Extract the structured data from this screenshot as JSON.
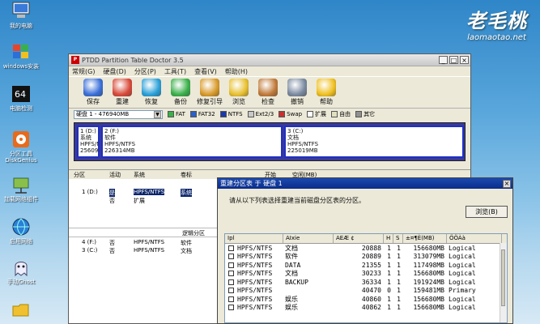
{
  "desktop": {
    "icons": [
      {
        "label": "我的电脑",
        "icon": "computer-icon"
      },
      {
        "label": "windows安装",
        "icon": "windows-install-icon"
      },
      {
        "label": "电脑检测",
        "icon": "cpu-test-icon"
      },
      {
        "label": "分区工具 DiskGenius",
        "icon": "diskgenius-icon"
      },
      {
        "label": "加载网络组件",
        "icon": "network-icon"
      },
      {
        "label": "启用网络",
        "icon": "globe-icon"
      },
      {
        "label": "手动Ghost",
        "icon": "ghost-icon"
      },
      {
        "label": "",
        "icon": "folder-icon"
      }
    ],
    "brand_big": "老毛桃",
    "brand_small": "laomaotao.net"
  },
  "window": {
    "title": "PTDD Partition Table Doctor 3.5",
    "menu": [
      "常规(G)",
      "硬盘(D)",
      "分区(P)",
      "工具(T)",
      "查看(V)",
      "帮助(H)"
    ],
    "toolbar": [
      {
        "label": "保存",
        "icon": "save-icon",
        "color": "#3a6fd8"
      },
      {
        "label": "重建",
        "icon": "rebuild-icon",
        "color": "#d84a3a"
      },
      {
        "label": "恢复",
        "icon": "recover-icon",
        "color": "#2aa0d8"
      },
      {
        "label": "备份",
        "icon": "backup-icon",
        "color": "#3ab04a"
      },
      {
        "label": "修复引导",
        "icon": "repair-boot-icon",
        "color": "#d89a2a"
      },
      {
        "label": "浏览",
        "icon": "browse-icon",
        "color": "#e8c030"
      },
      {
        "label": "检查",
        "icon": "check-icon",
        "color": "#c07a3a"
      },
      {
        "label": "撤销",
        "icon": "undo-icon",
        "color": "#7a8aa0"
      },
      {
        "label": "帮助",
        "icon": "help-icon",
        "color": "#f0c020"
      }
    ],
    "disk_select": "硬盘 1 - 476940MB",
    "legend": [
      {
        "label": "FAT",
        "color": "#3ab04a"
      },
      {
        "label": "FAT32",
        "color": "#2a60c8"
      },
      {
        "label": "NTFS",
        "color": "#1a3aa8"
      },
      {
        "label": "Ext2/3",
        "color": "#c8c8c8"
      },
      {
        "label": "Swap",
        "color": "#c83030"
      },
      {
        "label": "扩展",
        "color": "#ffffff"
      },
      {
        "label": "自由",
        "color": "#e0e0c0"
      },
      {
        "label": "其它",
        "color": "#909090"
      }
    ],
    "partitions_map": [
      {
        "text": "1 (D:)\n系统\nHPFS/N\n256093"
      },
      {
        "text": "2 (F:)\n软件\nHPFS/NTFS\n226314MB"
      },
      {
        "text": "3 (C:)\n文档\nHPFS/NTFS\n225019MB"
      }
    ],
    "table_headers": {
      "partition": "分区",
      "active": "活动",
      "system": "系统",
      "label": "卷标",
      "start": "开始",
      "free": "空闲(MB)"
    },
    "rows": [
      {
        "part": "1 (D:)",
        "active": "是",
        "system": "HPFS/NTFS",
        "label": "系统"
      },
      {
        "part": "",
        "active": "否",
        "system": "扩展",
        "label": ""
      },
      {
        "part": "4 (F:)",
        "active": "否",
        "system": "HPFS/NTFS",
        "label": "软件"
      },
      {
        "part": "3 (C:)",
        "active": "否",
        "system": "HPFS/NTFS",
        "label": "文档"
      }
    ],
    "logical_label": "逻辑分区"
  },
  "dialog": {
    "title": "重建分区表 于 硬盘 1",
    "prompt": "请从以下列表选择重建当前磁盘分区表的分区。",
    "browse": "浏览(B)",
    "headers": [
      "Ipl",
      "AIxie",
      "AEÆ ¢",
      "H",
      "S",
      "±¤¶È(MB)",
      "ÖÖÀà"
    ],
    "rows": [
      {
        "sys": "HPFS/NTFS",
        "name": "文档",
        "start": "20888",
        "h": "1",
        "s": "1",
        "size": "156680MB",
        "type": "Logical"
      },
      {
        "sys": "HPFS/NTFS",
        "name": "软件",
        "start": "20889",
        "h": "1",
        "s": "1",
        "size": "313079MB",
        "type": "Logical"
      },
      {
        "sys": "HPFS/NTFS",
        "name": "DATA",
        "start": "21355",
        "h": "1",
        "s": "1",
        "size": "117498MB",
        "type": "Logical"
      },
      {
        "sys": "HPFS/NTFS",
        "name": "文档",
        "start": "30233",
        "h": "1",
        "s": "1",
        "size": "156680MB",
        "type": "Logical"
      },
      {
        "sys": "HPFS/NTFS",
        "name": "BACKUP",
        "start": "36334",
        "h": "1",
        "s": "1",
        "size": "191924MB",
        "type": "Logical"
      },
      {
        "sys": "HPFS/NTFS",
        "name": "",
        "start": "40470",
        "h": "0",
        "s": "1",
        "size": "159481MB",
        "type": "Primary"
      },
      {
        "sys": "HPFS/NTFS",
        "name": "娱乐",
        "start": "40860",
        "h": "1",
        "s": "1",
        "size": "156680MB",
        "type": "Logical"
      },
      {
        "sys": "HPFS/NTFS",
        "name": "娱乐",
        "start": "40862",
        "h": "1",
        "s": "1",
        "size": "156680MB",
        "type": "Logical"
      }
    ]
  }
}
